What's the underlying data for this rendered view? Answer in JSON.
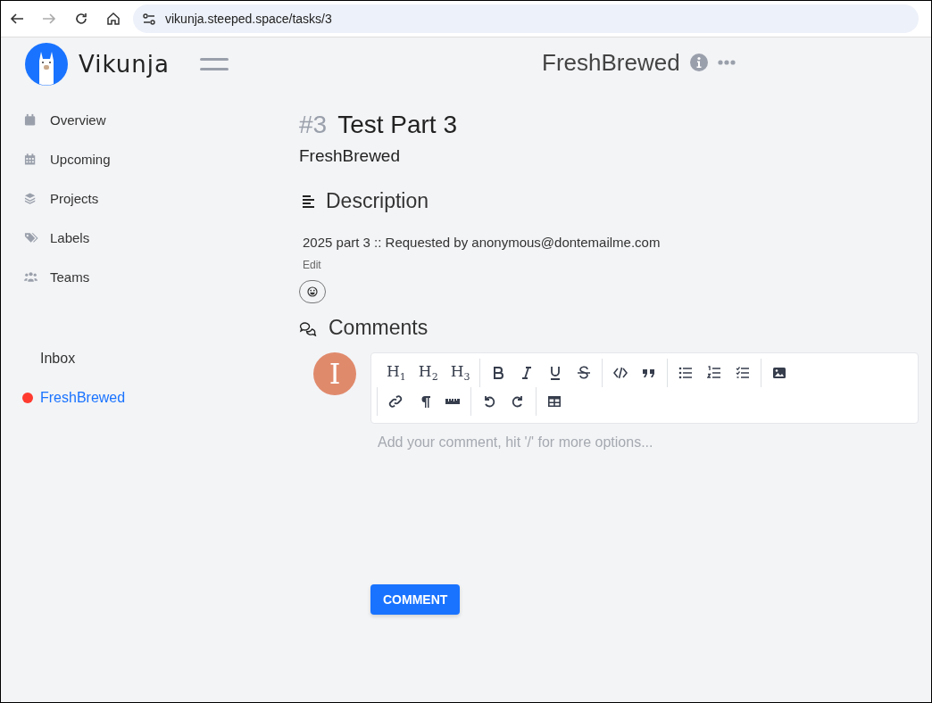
{
  "browser": {
    "nav": [
      {
        "kind": "back",
        "disabled": false
      },
      {
        "kind": "forward",
        "disabled": true
      },
      {
        "kind": "reload",
        "disabled": false
      },
      {
        "kind": "home",
        "disabled": false
      }
    ],
    "url": "vikunja.steeped.space/tasks/3"
  },
  "app": {
    "name": "Vikunja"
  },
  "header": {
    "title": "FreshBrewed"
  },
  "sidebar": {
    "items": [
      {
        "kind": "calendar",
        "label": "Overview"
      },
      {
        "kind": "grid-calendar",
        "label": "Upcoming"
      },
      {
        "kind": "layers",
        "label": "Projects"
      },
      {
        "kind": "tags",
        "label": "Labels"
      },
      {
        "kind": "people",
        "label": "Teams"
      }
    ],
    "projects": [
      {
        "label": "Inbox",
        "selected": false
      },
      {
        "label": "FreshBrewed",
        "selected": true,
        "color": "#ff3b30"
      }
    ]
  },
  "task": {
    "number": "#3",
    "title": "Test Part 3",
    "project": "FreshBrewed"
  },
  "description": {
    "heading": "Description",
    "text": "2025 part 3 :: Requested by anonymous@dontemailme.com",
    "edit": "Edit"
  },
  "comments": {
    "heading": "Comments",
    "avatar": "I",
    "toolbar": [
      [
        [
          {
            "kind": "text",
            "label": "H$_{1}$"
          },
          {
            "kind": "text",
            "label": "H$_{2}$"
          },
          {
            "kind": "text",
            "label": "H$_{3}$"
          }
        ],
        [
          {
            "kind": "bold"
          },
          {
            "kind": "italic"
          },
          {
            "kind": "underline"
          },
          {
            "kind": "strike"
          }
        ],
        [
          {
            "kind": "code"
          },
          {
            "kind": "quote"
          }
        ],
        [
          {
            "kind": "bullet-list"
          },
          {
            "kind": "ordered-list"
          },
          {
            "kind": "task-list"
          }
        ],
        [
          {
            "kind": "image"
          }
        ]
      ],
      [
        [
          {
            "kind": "link"
          },
          {
            "kind": "paragraph"
          },
          {
            "kind": "rule"
          }
        ],
        [
          {
            "kind": "undo"
          },
          {
            "kind": "redo"
          }
        ],
        [
          {
            "kind": "table"
          }
        ]
      ]
    ],
    "placeholder": "Add your comment, hit '/' for more options...",
    "button": "COMMENT"
  }
}
